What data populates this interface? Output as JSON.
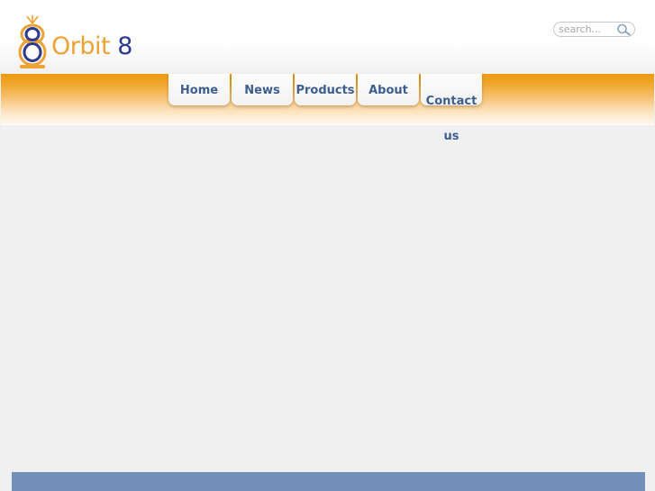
{
  "brand": {
    "name_part1": "Orbit",
    "name_part2": "8"
  },
  "search": {
    "placeholder": "search...",
    "icon": "magnifier-icon"
  },
  "nav": {
    "items": [
      {
        "label": "Home"
      },
      {
        "label": "News"
      },
      {
        "label": "Products"
      },
      {
        "label": "About"
      },
      {
        "label": "Contact us"
      }
    ]
  },
  "colors": {
    "brand_orange": "#eca234",
    "brand_blue": "#2e3a8c",
    "nav_text": "#3d5e8e",
    "band_orange": "#ec9a10",
    "page_bg": "#f0f0f0",
    "footer_bar": "#7390bb"
  }
}
